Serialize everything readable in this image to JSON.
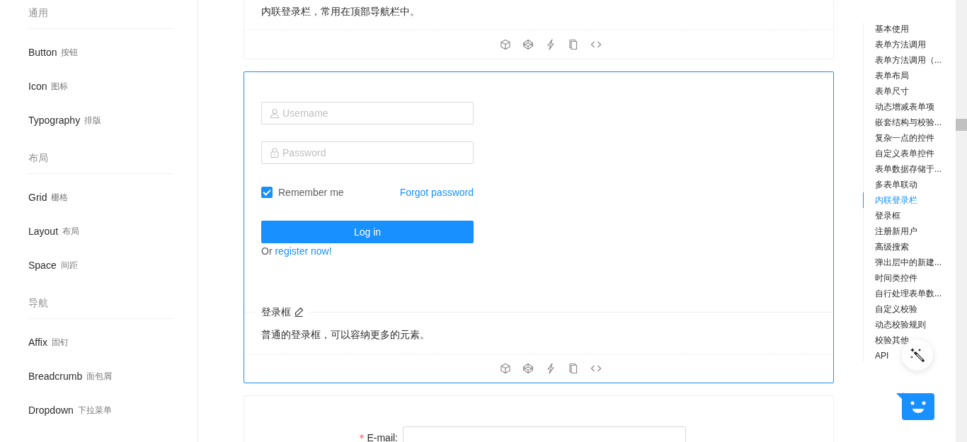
{
  "sidebar": {
    "groups": [
      {
        "title": "通用",
        "items": [
          {
            "label": "Button",
            "sublabel": "按钮"
          },
          {
            "label": "Icon",
            "sublabel": "图标"
          },
          {
            "label": "Typography",
            "sublabel": "排版"
          }
        ]
      },
      {
        "title": "布局",
        "items": [
          {
            "label": "Grid",
            "sublabel": "栅格"
          },
          {
            "label": "Layout",
            "sublabel": "布局"
          },
          {
            "label": "Space",
            "sublabel": "间距"
          }
        ]
      },
      {
        "title": "导航",
        "items": [
          {
            "label": "Affix",
            "sublabel": "固钉"
          },
          {
            "label": "Breadcrumb",
            "sublabel": "面包屑"
          },
          {
            "label": "Dropdown",
            "sublabel": "下拉菜单"
          }
        ]
      }
    ]
  },
  "demos": [
    {
      "kind": "description_only",
      "selected": false,
      "description": "内联登录栏，常用在顶部导航栏中。"
    },
    {
      "kind": "login",
      "selected": true,
      "title": "登录框",
      "description": "普通的登录框，可以容纳更多的元素。",
      "form": {
        "username_placeholder": "Username",
        "password_placeholder": "Password",
        "remember": {
          "label": "Remember me",
          "checked": true
        },
        "forgot": "Forgot password",
        "submit": "Log in",
        "register_prefix": "Or",
        "register_link": "register now!"
      }
    },
    {
      "kind": "register",
      "selected": false,
      "field": {
        "label": "E-mail:",
        "required": true,
        "required_mark": "*"
      }
    }
  ],
  "toc": {
    "items": [
      {
        "label": "基本使用",
        "selected": false
      },
      {
        "label": "表单方法调用",
        "selected": false
      },
      {
        "label": "表单方法调用（...",
        "selected": false
      },
      {
        "label": "表单布局",
        "selected": false
      },
      {
        "label": "表单尺寸",
        "selected": false
      },
      {
        "label": "动态增减表单项",
        "selected": false
      },
      {
        "label": "嵌套结构与校验...",
        "selected": false
      },
      {
        "label": "复杂一点的控件",
        "selected": false
      },
      {
        "label": "自定义表单控件",
        "selected": false
      },
      {
        "label": "表单数据存储于...",
        "selected": false
      },
      {
        "label": "多表单联动",
        "selected": false
      },
      {
        "label": "内联登录栏",
        "selected": true
      },
      {
        "label": "登录框",
        "selected": false
      },
      {
        "label": "注册新用户",
        "selected": false
      },
      {
        "label": "高级搜索",
        "selected": false
      },
      {
        "label": "弹出层中的新建...",
        "selected": false
      },
      {
        "label": "时间类控件",
        "selected": false
      },
      {
        "label": "自行处理表单数...",
        "selected": false
      },
      {
        "label": "自定义校验",
        "selected": false
      },
      {
        "label": "动态校验规则",
        "selected": false
      },
      {
        "label": "校验其他",
        "selected": false
      },
      {
        "label": "API",
        "selected": false
      }
    ]
  }
}
